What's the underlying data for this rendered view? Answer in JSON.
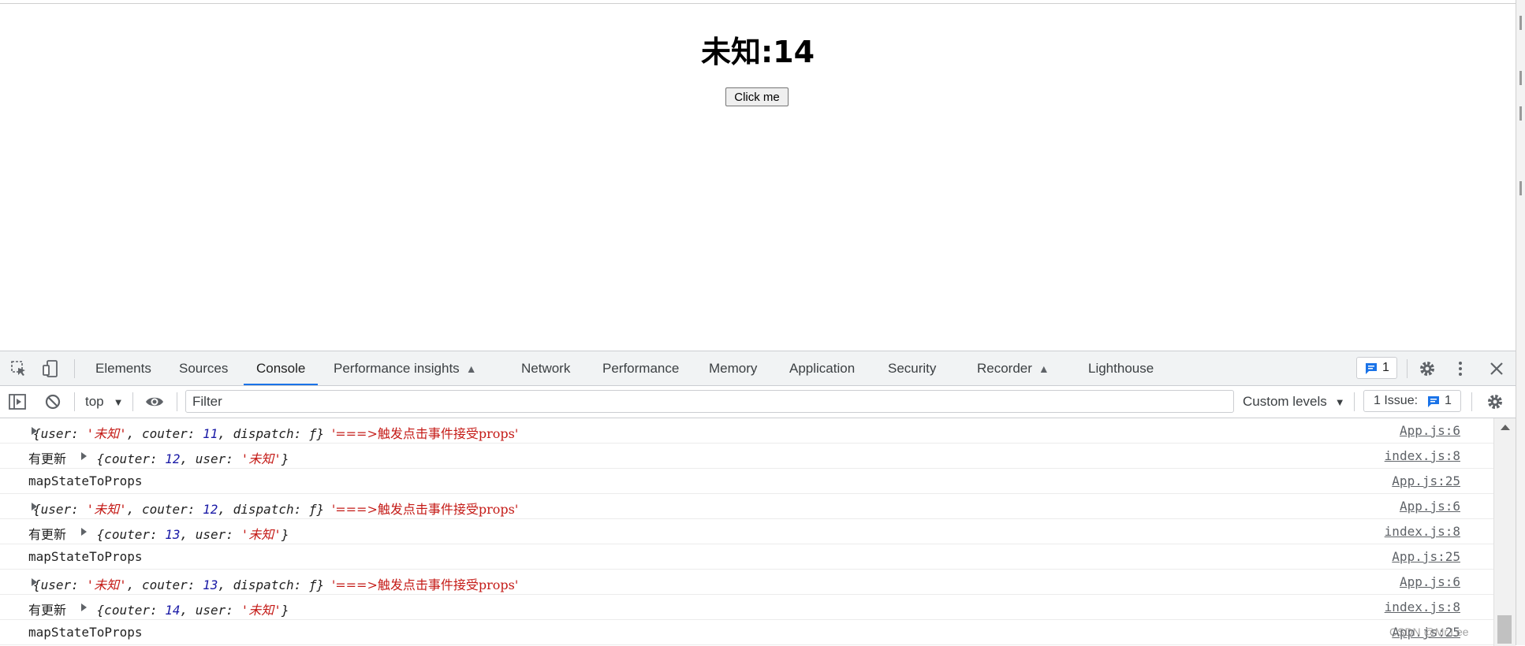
{
  "page": {
    "heading": "未知:14",
    "button_label": "Click me"
  },
  "devtools": {
    "tabs": [
      {
        "label": "Elements"
      },
      {
        "label": "Sources"
      },
      {
        "label": "Console",
        "active": true
      },
      {
        "label": "Performance insights",
        "experimental": true
      },
      {
        "label": "Network"
      },
      {
        "label": "Performance"
      },
      {
        "label": "Memory"
      },
      {
        "label": "Application"
      },
      {
        "label": "Security"
      },
      {
        "label": "Recorder",
        "experimental": true
      },
      {
        "label": "Lighthouse"
      }
    ],
    "message_count": "1",
    "accent_color": "#1a73e8",
    "filter": {
      "context": "top",
      "placeholder": "Filter",
      "levels_label": "Custom levels",
      "issues_label": "1 Issue:",
      "issues_count": "1"
    },
    "console_rows": [
      {
        "kind": "obj",
        "user": "未知",
        "couter": "11",
        "tail": "'===>触发点击事件接受props'",
        "source": "App.js:6"
      },
      {
        "kind": "upd",
        "prefix": "有更新",
        "couter": "12",
        "user": "未知",
        "source": "index.js:8"
      },
      {
        "kind": "plain",
        "text": "mapStateToProps",
        "source": "App.js:25"
      },
      {
        "kind": "obj",
        "user": "未知",
        "couter": "12",
        "tail": "'===>触发点击事件接受props'",
        "source": "App.js:6"
      },
      {
        "kind": "upd",
        "prefix": "有更新",
        "couter": "13",
        "user": "未知",
        "source": "index.js:8"
      },
      {
        "kind": "plain",
        "text": "mapStateToProps",
        "source": "App.js:25"
      },
      {
        "kind": "obj",
        "user": "未知",
        "couter": "13",
        "tail": "'===>触发点击事件接受props'",
        "source": "App.js:6"
      },
      {
        "kind": "upd",
        "prefix": "有更新",
        "couter": "14",
        "user": "未知",
        "source": "index.js:8"
      },
      {
        "kind": "plain",
        "text": "mapStateToProps",
        "source": "App.js:25"
      }
    ]
  },
  "watermark": "CSDN @Mr.Lee"
}
